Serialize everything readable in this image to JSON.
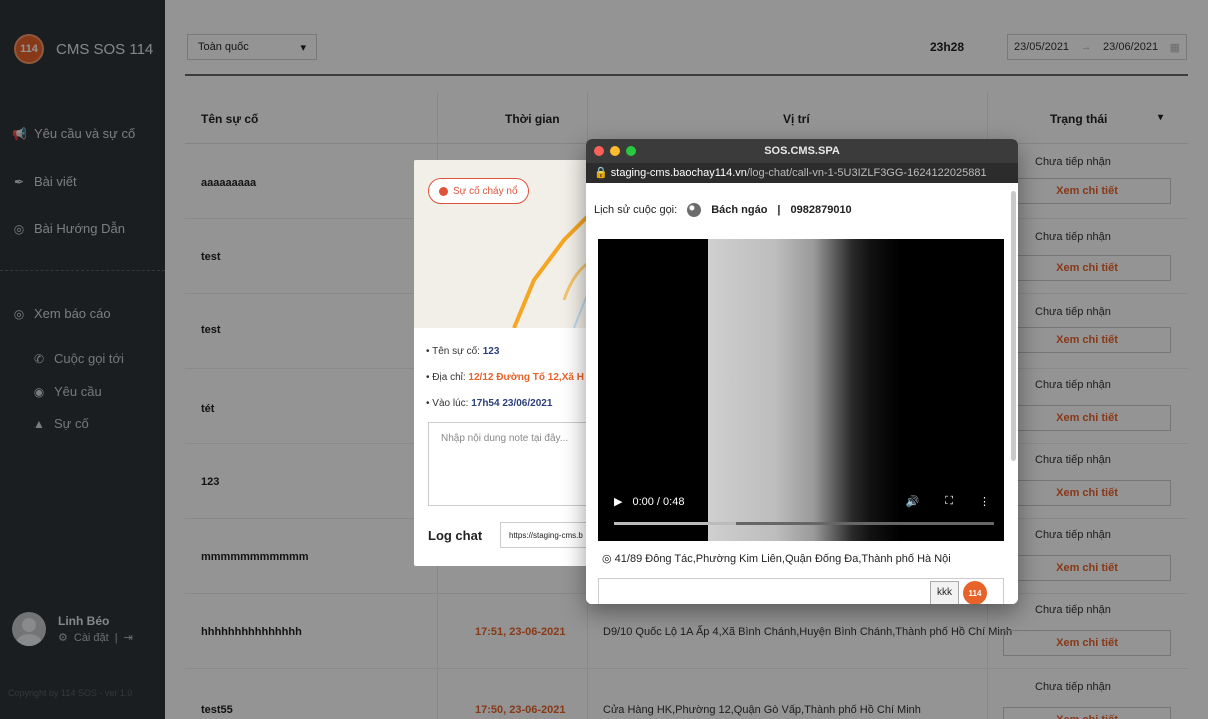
{
  "sidebar": {
    "logo_text": "114",
    "brand": "CMS SOS 114",
    "items": [
      {
        "label": "Yêu cầu và sự cố",
        "icon": "megaphone-icon"
      },
      {
        "label": "Bài viết",
        "icon": "pencil-icon"
      },
      {
        "label": "Bài Hướng Dẫn",
        "icon": "book-icon"
      },
      {
        "label": "Xem báo cáo",
        "icon": "report-icon"
      }
    ],
    "sub_items": [
      {
        "label": "Cuộc gọi tới",
        "icon": "phone-icon"
      },
      {
        "label": "Yêu cầu",
        "icon": "chat-icon"
      },
      {
        "label": "Sự cố",
        "icon": "fire-icon"
      }
    ],
    "user_name": "Linh Béo",
    "settings_label": "Cài đặt",
    "copyright": "Copyright by 114 SOS - ver 1.0"
  },
  "filters": {
    "region": "Toàn quốc",
    "current_time": "23h28",
    "date_from": "23/05/2021",
    "date_to": "23/06/2021"
  },
  "table": {
    "headers": [
      "Tên sự cố",
      "Thời gian",
      "Vị trí",
      "Trạng thái"
    ],
    "rows": [
      {
        "name": "aaaaaaaaa",
        "time": "",
        "location": "",
        "status": "Chưa tiếp nhận",
        "action": "Xem chi tiết"
      },
      {
        "name": "test",
        "time": "",
        "location": "",
        "status": "Chưa tiếp nhận",
        "action": "Xem chi tiết"
      },
      {
        "name": "test",
        "time": "",
        "location": "",
        "status": "Chưa tiếp nhận",
        "action": "Xem chi tiết"
      },
      {
        "name": "tét",
        "time": "",
        "location": "",
        "status": "Chưa tiếp nhận",
        "action": "Xem chi tiết"
      },
      {
        "name": "123",
        "time": "",
        "location": "",
        "status": "Chưa tiếp nhận",
        "action": "Xem chi tiết"
      },
      {
        "name": "mmmmmmmmmmm",
        "time": "",
        "location": "",
        "status": "Chưa tiếp nhận",
        "action": "Xem chi tiết"
      },
      {
        "name": "hhhhhhhhhhhhhhh",
        "time": "17:51, 23-06-2021",
        "location": "D9/10 Quốc Lộ 1A Ấp 4,Xã Bình Chánh,Huyện Bình Chánh,Thành phố Hồ Chí Minh",
        "status": "Chưa tiếp nhận",
        "action": "Xem chi tiết"
      },
      {
        "name": "test55",
        "time": "17:50, 23-06-2021",
        "location": "Cửa Hàng HK,Phường 12,Quận Gò Vấp,Thành phố Hồ Chí Minh",
        "status": "Chưa tiếp nhận",
        "action": "Xem chi tiết"
      }
    ]
  },
  "incident_popup": {
    "tag": "Sự cố cháy nổ",
    "name_label": "Tên sự cố:",
    "name_value": "123",
    "address_label": "Địa chỉ:",
    "address_value": "12/12 Đường Tố 12,Xã H",
    "time_label": "Vào lúc:",
    "time_value": "17h54 23/06/2021",
    "note_placeholder": "Nhập nội dung note tại đây...",
    "logchat_label": "Log chat",
    "logchat_link": "https://staging-cms.b"
  },
  "browser_window": {
    "title": "SOS.CMS.SPA",
    "url_host": "staging-cms.baochay114.vn",
    "url_path": "/log-chat/call-vn-1-5U3IZLF3GG-1624122025881",
    "history_label": "Lịch sử cuộc gọi:",
    "caller_name": "Bách ngáo",
    "caller_phone": "0982879010",
    "video_time": "0:00 / 0:48",
    "video_progress": 0.32,
    "location": "41/89 Đông Tác,Phường Kim Liên,Quận Đống Đa,Thành phố Hà Nội",
    "send_button": "kkk",
    "logo_text": "114"
  }
}
